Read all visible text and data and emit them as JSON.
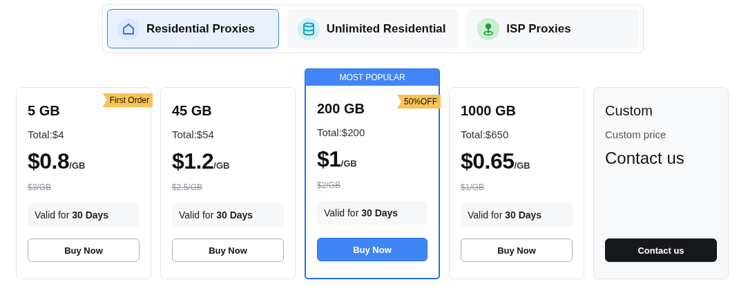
{
  "tabs": [
    {
      "label": "Residential Proxies",
      "kind": "home",
      "selected": true
    },
    {
      "label": "Unlimited Residential",
      "kind": "stack",
      "selected": false
    },
    {
      "label": "ISP Proxies",
      "kind": "pin",
      "selected": false
    }
  ],
  "plans": [
    {
      "kind": "standard",
      "featured": false,
      "ribbon": "First Order",
      "size": "5 GB",
      "total": "Total:$4",
      "price": "$0.8",
      "unit": "/GB",
      "old_price": "$3/GB",
      "validity": "Valid for **30 Days**",
      "button": "Buy Now"
    },
    {
      "kind": "standard",
      "featured": false,
      "size": "45 GB",
      "total": "Total:$54",
      "price": "$1.2",
      "unit": "/GB",
      "old_price": "$2.5/GB",
      "validity": "Valid for **30 Days**",
      "button": "Buy Now"
    },
    {
      "kind": "standard",
      "featured": true,
      "banner": "MOST POPULAR",
      "ribbon": "50%OFF",
      "size": "200 GB",
      "total": "Total:$200",
      "price": "$1",
      "unit": "/GB",
      "old_price": "$2/GB",
      "validity": "Valid for **30 Days**",
      "button": "Buy Now"
    },
    {
      "kind": "standard",
      "featured": false,
      "size": "1000 GB",
      "total": "Total:$650",
      "price": "$0.65",
      "unit": "/GB",
      "old_price": "$1/GB",
      "validity": "Valid for **30 Days**",
      "button": "Buy Now"
    },
    {
      "kind": "custom",
      "featured": false,
      "size": "Custom",
      "total": "Custom price",
      "price": "Contact us",
      "button": "Contact us"
    }
  ]
}
